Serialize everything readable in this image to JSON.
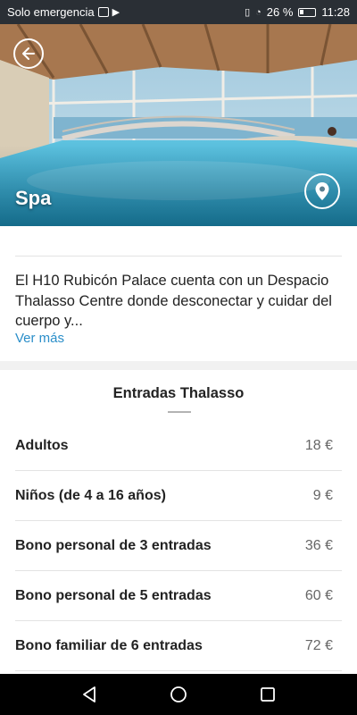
{
  "status_bar": {
    "carrier": "Solo emergencia",
    "battery_percent": "26 %",
    "time": "11:28"
  },
  "header": {
    "title": "Spa"
  },
  "icons": {
    "back": "arrow-left-icon",
    "location": "map-pin-icon",
    "nav_back": "triangle-back-icon",
    "nav_home": "circle-home-icon",
    "nav_recents": "square-recents-icon"
  },
  "description": {
    "text": "El H10 Rubicón Palace cuenta con un Despacio Thalasso Centre donde desconectar y cuidar del cuerpo y...",
    "more_link": "Ver más"
  },
  "section": {
    "title": "Entradas Thalasso"
  },
  "prices": [
    {
      "name": "Adultos",
      "value": "18 €"
    },
    {
      "name": "Niños (de 4 a 16 años)",
      "value": "9 €"
    },
    {
      "name": "Bono personal de 3 entradas",
      "value": "36 €"
    },
    {
      "name": "Bono personal de 5 entradas",
      "value": "60 €"
    },
    {
      "name": "Bono familiar de 6 entradas",
      "value": "72 €"
    }
  ],
  "colors": {
    "link": "#2a8ec9",
    "status_bar": "#2a2f35",
    "nav_bar": "#000000"
  }
}
